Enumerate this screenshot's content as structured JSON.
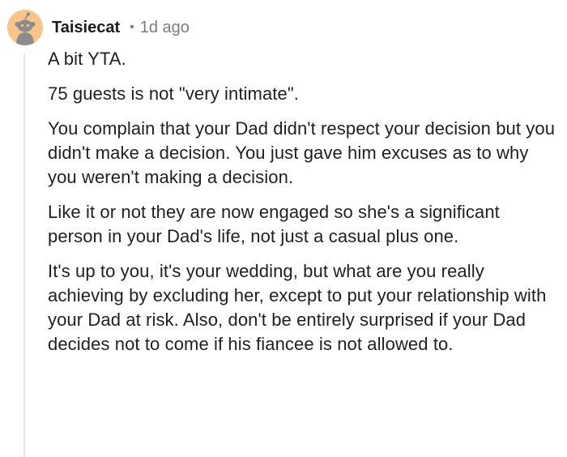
{
  "comment": {
    "author": "Taisiecat",
    "separator": "•",
    "age": "1d ago",
    "paragraphs": [
      "A bit YTA.",
      "75 guests is not \"very intimate\".",
      "You complain that your Dad didn't respect your decision but you didn't make a decision. You just gave him excuses as to why you weren't making a decision.",
      "Like it or not they are now engaged so she's a significant person in your Dad's life, not just a casual plus one.",
      "It's up to you, it's your wedding, but what are you really achieving by excluding her, except to put your relationship with your Dad at risk. Also, don't be entirely surprised if your Dad decides not to come if his fiancee is not allowed to."
    ]
  },
  "colors": {
    "avatar_background": "#f7c58b",
    "avatar_figure": "#8c8c8c",
    "thread_line": "#e4e6e8",
    "muted_text": "#7c7c7c"
  },
  "icons": {
    "avatar": "snoo-avatar-icon"
  }
}
